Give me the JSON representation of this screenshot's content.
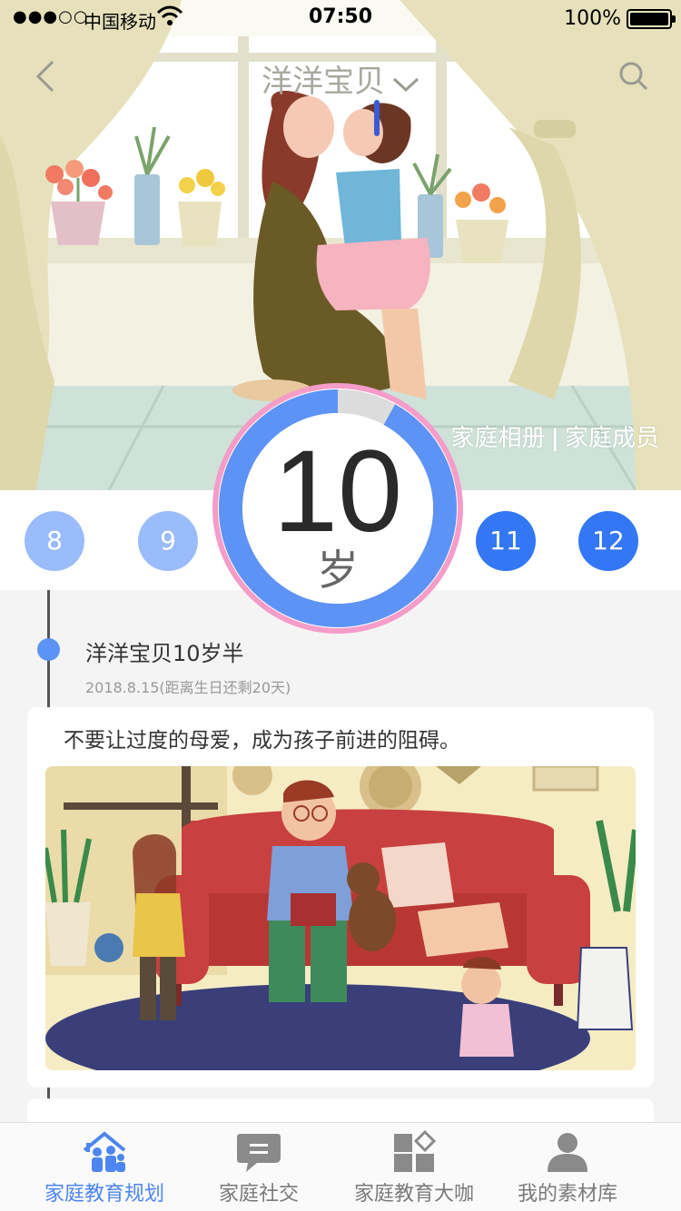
{
  "status_bar": {
    "signal": "●●●○○",
    "carrier": "中国移动",
    "time": "07:50",
    "battery": "100%"
  },
  "nav": {
    "title": "洋洋宝贝",
    "back_icon": "chevron-left-icon",
    "search_icon": "search-icon",
    "dropdown_icon": "chevron-down-icon"
  },
  "hero": {
    "album_link": "家庭相册",
    "separator": "|",
    "members_link": "家庭成员"
  },
  "age_selector": {
    "ages_before": [
      "8",
      "9"
    ],
    "current": "10",
    "current_unit": "岁",
    "ages_after": [
      "11",
      "12"
    ],
    "progress_fraction": 0.92,
    "colors": {
      "past": "#9bbcfc",
      "future": "#3377f5",
      "ring": "#5d93f5",
      "outer_ring": "#f59cc8"
    }
  },
  "timeline": {
    "entry": {
      "title": "洋洋宝贝10岁半",
      "date": "2018.8.15(距离生日还剩20天)",
      "quote": "不要让过度的母爱，成为孩子前进的阻碍。"
    }
  },
  "tab_bar": {
    "tabs": [
      {
        "label": "家庭教育规划",
        "icon": "family-house-icon",
        "active": true
      },
      {
        "label": "家庭社交",
        "icon": "chat-bubble-icon",
        "active": false
      },
      {
        "label": "家庭教育大咖",
        "icon": "apps-grid-icon",
        "active": false
      },
      {
        "label": "我的素材库",
        "icon": "user-profile-icon",
        "active": false
      }
    ],
    "colors": {
      "active": "#4d86f0",
      "inactive": "#7a7a7a"
    }
  }
}
